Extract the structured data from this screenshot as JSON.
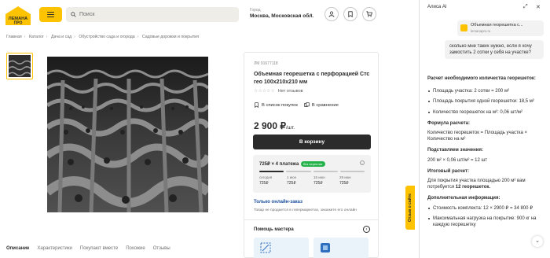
{
  "brand": {
    "logo_text_top": "ЛЕМАНА",
    "logo_text_bottom": "ПРО",
    "accent": "#fdc300"
  },
  "search": {
    "placeholder": "Поиск"
  },
  "city": {
    "label": "Город",
    "value": "Москва, Московская обл."
  },
  "header_icons": [
    "user-icon",
    "bookmark-icon",
    "cart-icon"
  ],
  "breadcrumb": [
    "Главная",
    "Каталог",
    "Дача и сад",
    "Обустройство сада и огорода",
    "Садовые дорожки и покрытия"
  ],
  "product": {
    "sku": "ЛМ 91677118",
    "title": "Объемная георешетка с перфорацией Стс гео 100х210х210 мм",
    "reviews": "Нет отзывов",
    "shopping_list": "В список покупок",
    "compare": "В сравнение",
    "price": "2 900 ₽",
    "price_unit": "/шт.",
    "cart_button": "В корзину",
    "split": {
      "head": "725₽ × 4 платежа",
      "badge": "без переплат",
      "payments": [
        {
          "date": "сегодня",
          "amount": "725₽"
        },
        {
          "date": "1 июн",
          "amount": "725₽"
        },
        {
          "date": "15 июн",
          "amount": "725₽"
        },
        {
          "date": "29 июн",
          "amount": "725₽"
        }
      ]
    },
    "online_only": "Только онлайн-заказ",
    "online_note": "Товар не продается в гипермаркетах, закажите его онлайн",
    "master_help": "Помощь мастера"
  },
  "tabs": [
    "Описание",
    "Характеристики",
    "Покупают вместе",
    "Похожие",
    "Отзывы"
  ],
  "site_tab": "Отзыв о сайте",
  "ai_panel": {
    "title": "Алиса AI",
    "source_title": "Объемная георешетка с...",
    "source_domain": "lemanapro.ru",
    "question": "сколько мне таких нужно, если я хочу замостить 2 сотки у себя на участке?",
    "answer_heading": "Расчет необходимого количества георешеток:",
    "bullets": [
      "Площадь участка: 2 сотки = 200 м²",
      "Площадь покрытия одной георешетки: 18,5 м²",
      "Количество георешеток на м²: 0,06 шт/м²"
    ],
    "formula_heading": "Формула расчета:",
    "formula": "Количество георешеток = Площадь участка × Количество на м²",
    "subst_heading": "Подставляем значения:",
    "subst": "200 м² × 0,06 шт/м² = 12 шт",
    "result_heading": "Итоговый расчет:",
    "result_pre": "Для покрытия участка площадью 200 м² вам потребуется ",
    "result_bold": "12 георешеток.",
    "extra_heading": "Дополнительная информация:",
    "extra_bullets": [
      "Стоимость комплекта: 12 × 2900 ₽ = 34 800 ₽",
      "Максимальная нагрузка на покрытие: 900 кг на каждую георешетку"
    ]
  }
}
